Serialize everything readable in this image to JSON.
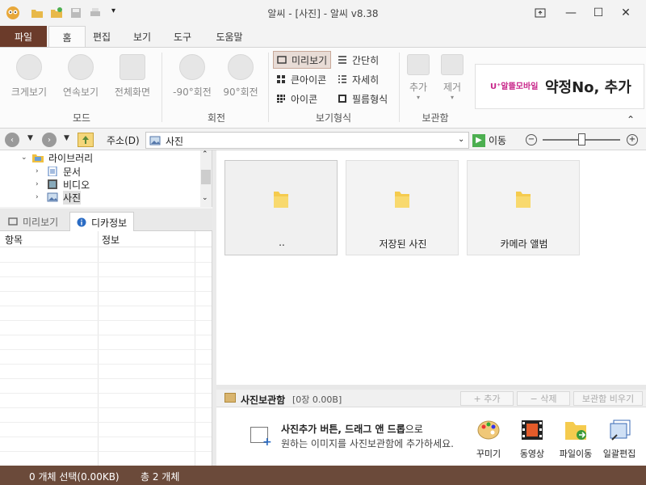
{
  "window": {
    "title": "알씨 - [사진] - 알씨 v8.38"
  },
  "ribbon_tabs": [
    {
      "label": "파일"
    },
    {
      "label": "홈"
    },
    {
      "label": "편집"
    },
    {
      "label": "보기"
    },
    {
      "label": "도구"
    },
    {
      "label": "도움말"
    }
  ],
  "ribbon": {
    "mode_group": {
      "label": "모드",
      "buttons": [
        {
          "label": "크게보기",
          "icon": "magnifier-icon"
        },
        {
          "label": "연속보기",
          "icon": "play-icon"
        },
        {
          "label": "전체화면",
          "icon": "fullscreen-icon"
        }
      ]
    },
    "rotate_group": {
      "label": "회전",
      "buttons": [
        {
          "label": "-90°회전",
          "icon": "rotate-left-icon"
        },
        {
          "label": "90°회전",
          "icon": "rotate-right-icon"
        }
      ]
    },
    "view_group": {
      "label": "보기형식",
      "options": [
        {
          "label": "미리보기",
          "icon": "preview-icon",
          "active": true
        },
        {
          "label": "간단히",
          "icon": "list-icon"
        },
        {
          "label": "큰아이콘",
          "icon": "large-icons-icon"
        },
        {
          "label": "자세히",
          "icon": "details-icon"
        },
        {
          "label": "아이콘",
          "icon": "icons-icon"
        },
        {
          "label": "필름형식",
          "icon": "film-icon"
        }
      ]
    },
    "box_group": {
      "label": "보관함",
      "buttons": [
        {
          "label": "추가",
          "icon": "box-add-icon"
        },
        {
          "label": "제거",
          "icon": "box-remove-icon"
        }
      ]
    },
    "ad": {
      "logo": "U⁺알뜰모바일",
      "text": "약정No, 추가"
    }
  },
  "address_bar": {
    "label": "주소(D)",
    "value": "사진",
    "go_label": "이동"
  },
  "tree": {
    "items": [
      {
        "label": "라이브러리",
        "expanded": true
      },
      {
        "label": "문서"
      },
      {
        "label": "비디오"
      },
      {
        "label": "사진",
        "selected": true
      }
    ]
  },
  "left_tabs": [
    {
      "label": "미리보기"
    },
    {
      "label": "디카정보",
      "active": true
    }
  ],
  "info_table": {
    "headers": [
      "항목",
      "정보"
    ]
  },
  "folders": [
    {
      "label": ".."
    },
    {
      "label": "저장된 사진"
    },
    {
      "label": "카메라 앨범"
    }
  ],
  "photo_box": {
    "title": "사진보관함",
    "count": "[0장 0.00B]",
    "buttons": [
      "+ 추가",
      "− 삭제",
      "보관함 비우기"
    ],
    "hint_bold": "사진추가 버튼, 드래그 앤 드롭",
    "hint_tail": "으로",
    "hint_line2": "원하는 이미지를 사진보관함에 추가하세요.",
    "quick_actions": [
      {
        "label": "꾸미기",
        "icon": "palette-icon"
      },
      {
        "label": "동영상",
        "icon": "video-icon"
      },
      {
        "label": "파일이동",
        "icon": "folder-move-icon"
      },
      {
        "label": "일괄편집",
        "icon": "batch-edit-icon"
      }
    ]
  },
  "status": {
    "selected": "0 개체 선택(0.00KB)",
    "total": "총 2 개체"
  },
  "colors": {
    "accent": "#6b3b2a",
    "statusbar": "#6b4a3a",
    "folder": "#f5cb4e"
  }
}
